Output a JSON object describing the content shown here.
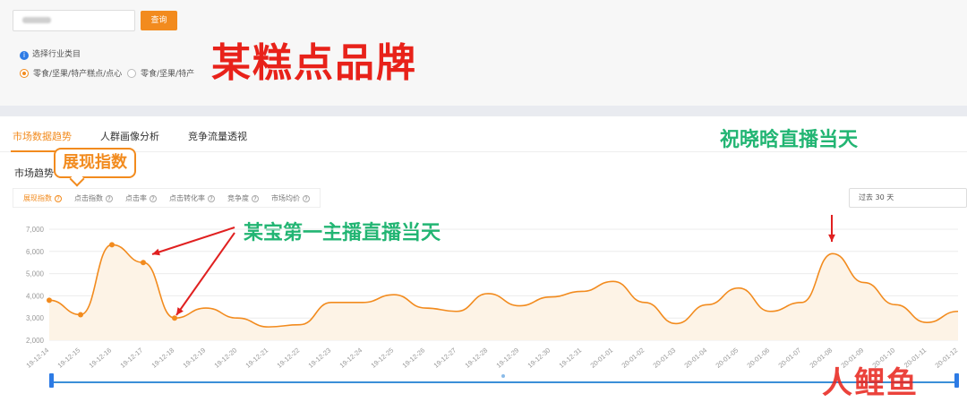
{
  "search": {
    "button_label": "查询"
  },
  "category": {
    "label": "选择行业类目",
    "options": [
      {
        "label": "零食/坚果/特产糕点/点心",
        "selected": true
      },
      {
        "label": "零食/坚果/特产",
        "selected": false
      }
    ]
  },
  "brand_title": "某糕点品牌",
  "tabs": [
    {
      "label": "市场数据趋势",
      "active": true
    },
    {
      "label": "人群画像分析",
      "active": false
    },
    {
      "label": "竞争流量透视",
      "active": false
    }
  ],
  "trend_title": "市场趋势",
  "metric_chips": [
    {
      "label": "展现指数",
      "active": true
    },
    {
      "label": "点击指数",
      "active": false
    },
    {
      "label": "点击率",
      "active": false
    },
    {
      "label": "点击转化率",
      "active": false
    },
    {
      "label": "竞争度",
      "active": false
    },
    {
      "label": "市场均价",
      "active": false
    }
  ],
  "range_select": {
    "value": "过去 30 天"
  },
  "annotations": {
    "metric_callout": "展现指数",
    "anchor_live": "某宝第一主播直播当天",
    "celebrity_live": "祝晓晗直播当天"
  },
  "watermark": "人鲤鱼",
  "colors": {
    "accent": "#f28b1e",
    "annotation_red": "#e8221a",
    "annotation_green": "#22b573"
  },
  "chart_data": {
    "type": "line",
    "title": "",
    "xlabel": "",
    "ylabel": "",
    "ylim": [
      2000,
      7000
    ],
    "yticks": [
      2000,
      3000,
      4000,
      5000,
      6000,
      7000
    ],
    "ytick_labels": [
      "2,000",
      "3,000",
      "4,000",
      "5,000",
      "6,000",
      "7,000"
    ],
    "grid": true,
    "categories": [
      "19-12-14",
      "19-12-15",
      "19-12-16",
      "19-12-17",
      "19-12-18",
      "19-12-19",
      "19-12-20",
      "19-12-21",
      "19-12-22",
      "19-12-23",
      "19-12-24",
      "19-12-25",
      "19-12-26",
      "19-12-27",
      "19-12-28",
      "19-12-29",
      "19-12-30",
      "19-12-31",
      "20-01-01",
      "20-01-02",
      "20-01-03",
      "20-01-04",
      "20-01-05",
      "20-01-06",
      "20-01-07",
      "20-01-08",
      "20-01-09",
      "20-01-10",
      "20-01-11",
      "20-01-12"
    ],
    "values": [
      3800,
      3150,
      6300,
      5500,
      3000,
      3450,
      3000,
      2600,
      2700,
      3700,
      3700,
      4050,
      3450,
      3300,
      4100,
      3550,
      3950,
      4200,
      4650,
      3700,
      2750,
      3600,
      4350,
      3300,
      3700,
      5900,
      4600,
      3600,
      2800,
      3300
    ],
    "marked_points": [
      0,
      1,
      2,
      3,
      4
    ]
  }
}
